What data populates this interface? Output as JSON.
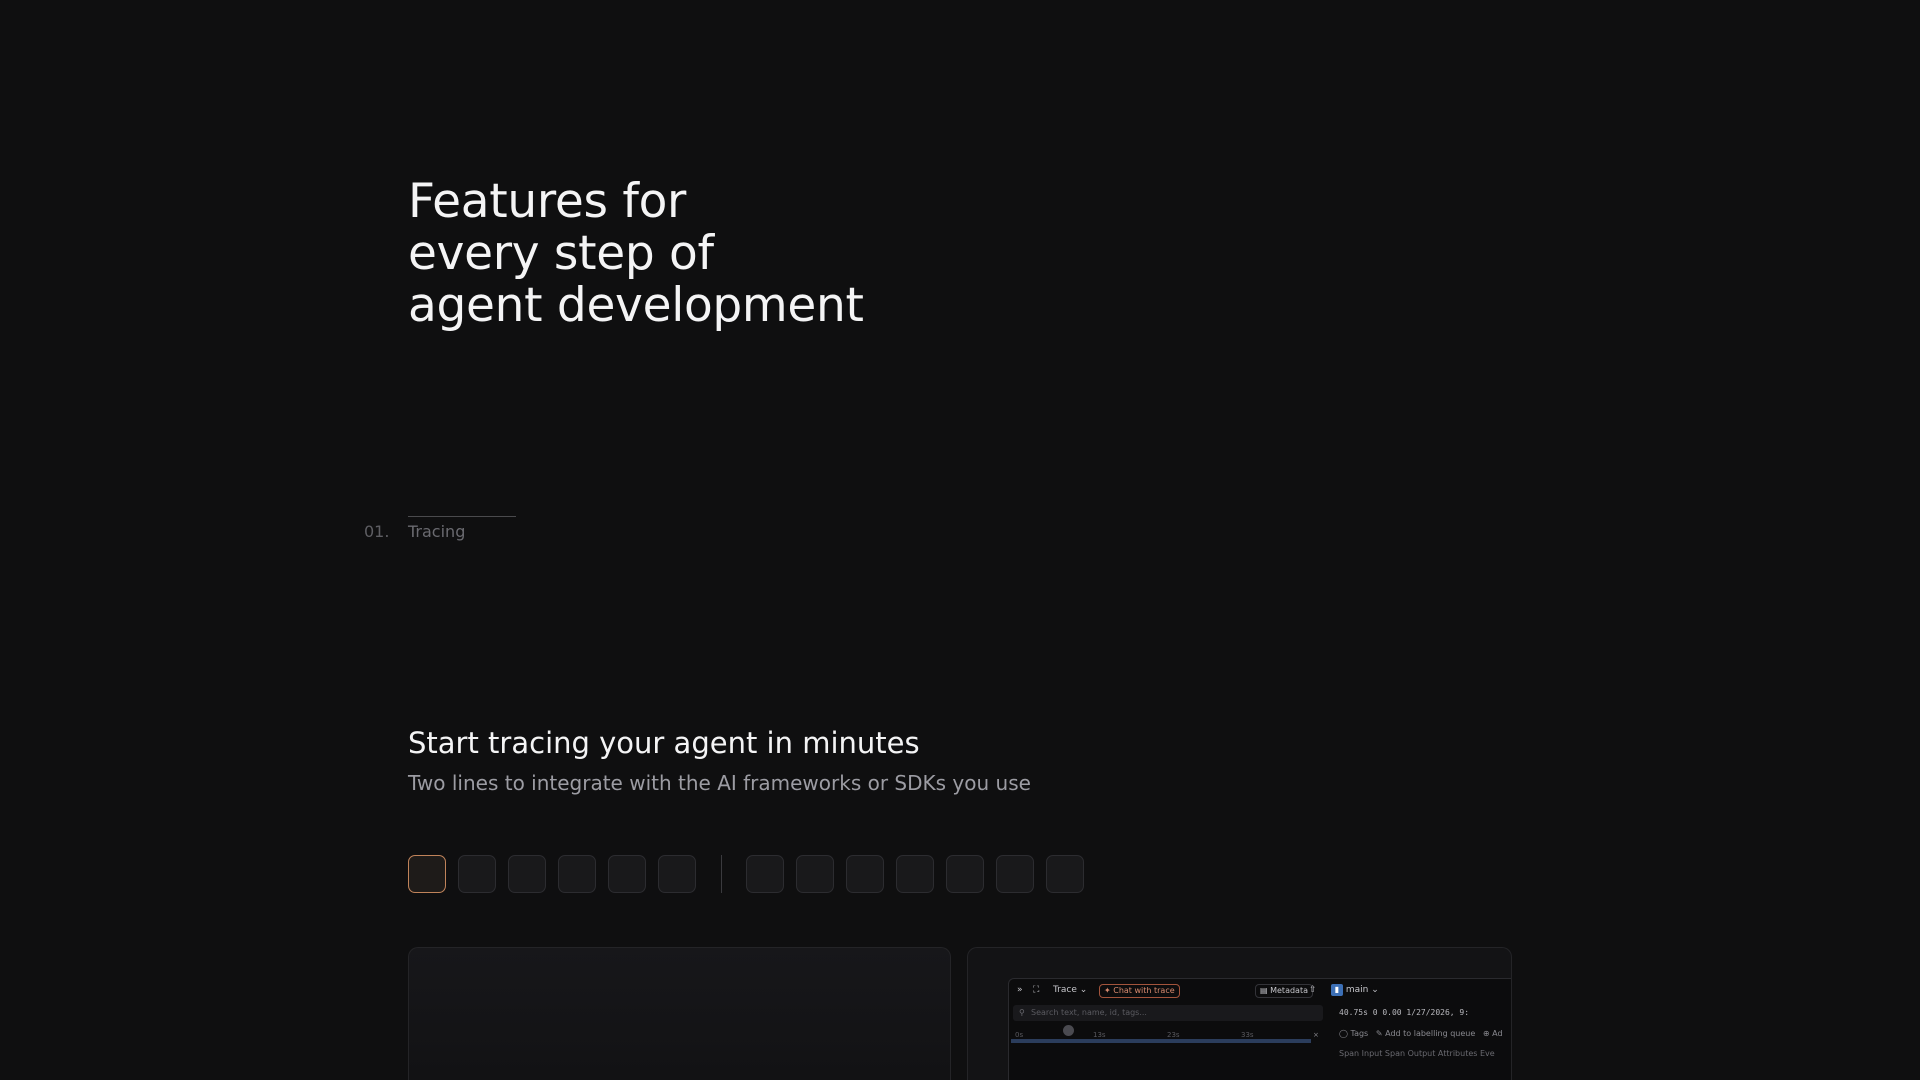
{
  "hero": {
    "title_lines": [
      "Features for",
      "every step of",
      "agent development"
    ]
  },
  "step": {
    "number": "01.",
    "label": "Tracing"
  },
  "section": {
    "title": "Start tracing your agent in minutes",
    "subtitle": "Two lines to integrate with the AI frameworks or SDKs you use"
  },
  "colors": {
    "background": "#0f0f10",
    "active_tile_border": "#c0835a",
    "chat_chip": "#d98b6f"
  },
  "trace_preview": {
    "trace_label": "Trace",
    "chat_button": "Chat with trace",
    "metadata_button": "Metadata",
    "branch": "main",
    "search_placeholder": "Search text, name, id, tags...",
    "stats": "40.75s  0  0.00   1/27/2026, 9:",
    "tags_label": "Tags",
    "labelling_queue": "Add to labelling queue",
    "add_label": "Ad",
    "timeline_ticks": [
      "0s",
      "13s",
      "23s",
      "33s"
    ],
    "tabs": "Span Input   Span Output   Attributes   Eve"
  }
}
